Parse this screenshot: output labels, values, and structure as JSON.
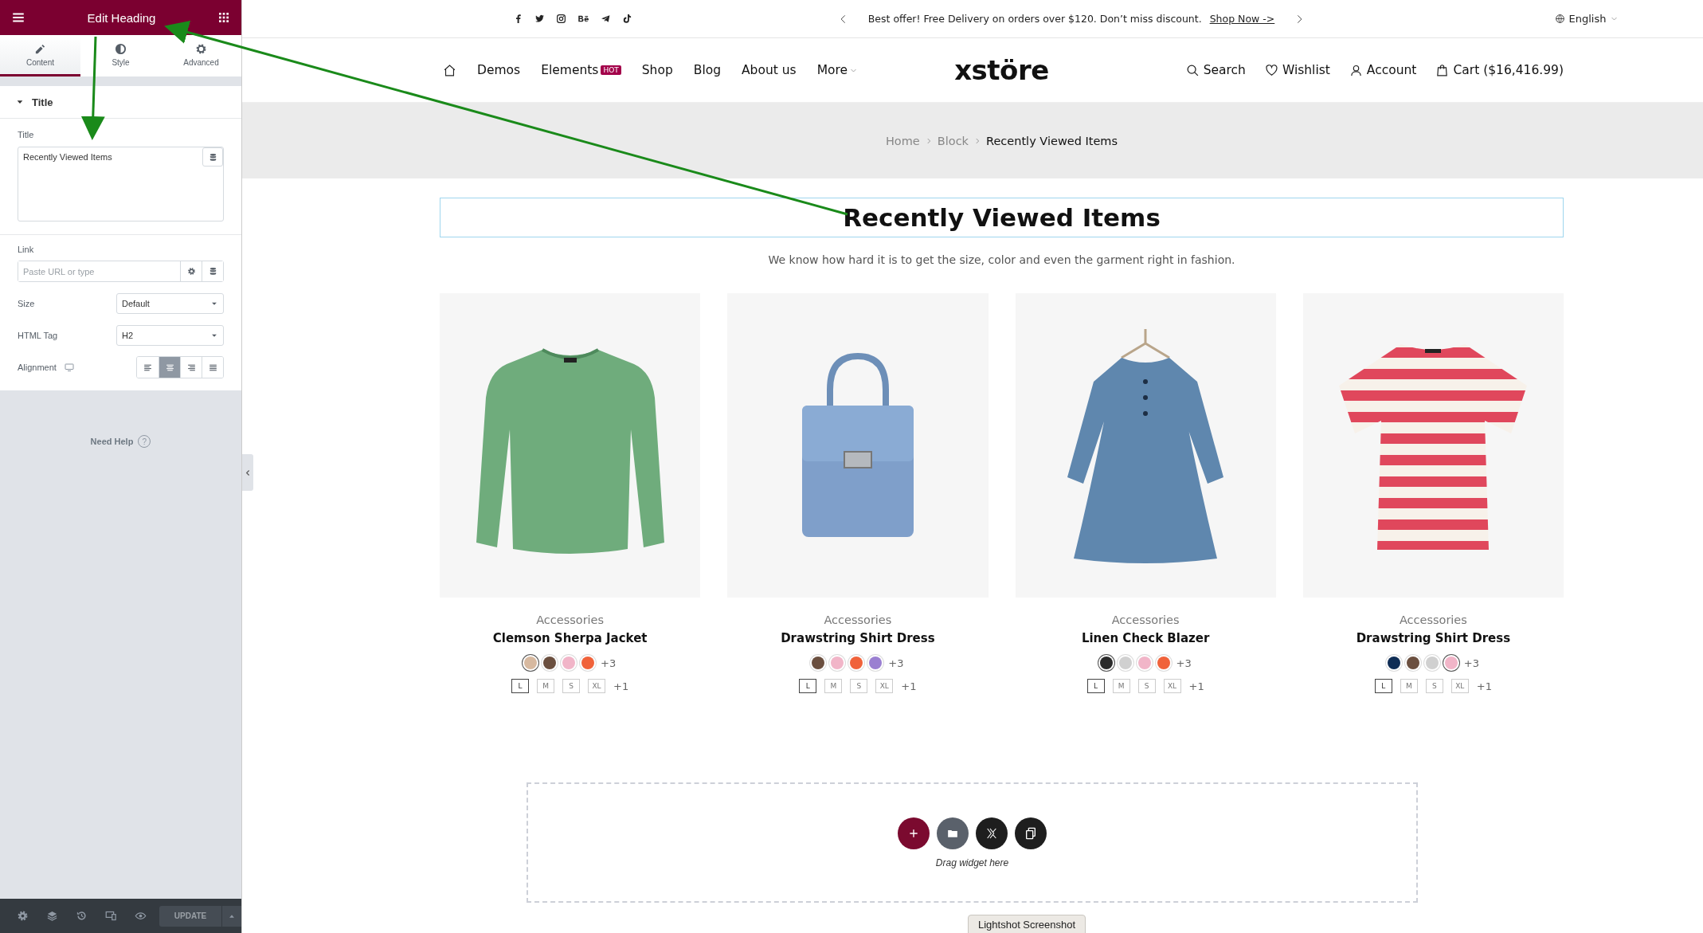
{
  "editor": {
    "title": "Edit Heading",
    "tabs": [
      {
        "label": "Content",
        "kind": "pencil",
        "selected": true
      },
      {
        "label": "Style",
        "kind": "contrast",
        "selected": false
      },
      {
        "label": "Advanced",
        "kind": "gear",
        "selected": false
      }
    ],
    "section": {
      "title": "Title",
      "expanded": true
    },
    "title_label": "Title",
    "title_value": "Recently Viewed Items",
    "link_label": "Link",
    "link_placeholder": "Paste URL or type",
    "size_label": "Size",
    "size_value": "Default",
    "tag_label": "HTML Tag",
    "tag_value": "H2",
    "alignment_label": "Alignment",
    "alignment_options": [
      {
        "kind": "left",
        "selected": false
      },
      {
        "kind": "center",
        "selected": true
      },
      {
        "kind": "right",
        "selected": false
      },
      {
        "kind": "justify",
        "selected": false
      }
    ],
    "need_help": "Need Help",
    "help_glyph": "?",
    "update_button": "UPDATE"
  },
  "top_bar": {
    "socials": [
      {
        "kind": "facebook"
      },
      {
        "kind": "twitter"
      },
      {
        "kind": "instagram"
      },
      {
        "kind": "behance"
      },
      {
        "kind": "telegram"
      },
      {
        "kind": "tiktok"
      }
    ],
    "promo": "Best offer! Free Delivery on orders over $120. Don’t miss discount.",
    "promo_link": "Shop Now ->",
    "language": "English"
  },
  "nav": {
    "items": [
      {
        "label": "Demos",
        "dropdown": false
      },
      {
        "label": "Elements",
        "badge": "HOT",
        "dropdown": false
      },
      {
        "label": "Shop",
        "dropdown": false
      },
      {
        "label": "Blog",
        "dropdown": false
      },
      {
        "label": "About us",
        "dropdown": false
      },
      {
        "label": "More",
        "dropdown": true
      }
    ],
    "logo": "xstöre",
    "actions": [
      {
        "kind": "search",
        "label": "Search"
      },
      {
        "kind": "heart",
        "label": "Wishlist"
      },
      {
        "kind": "user",
        "label": "Account"
      },
      {
        "kind": "bag",
        "label": "Cart ($16,416.99)"
      }
    ]
  },
  "breadcrumb": [
    {
      "label": "Home",
      "current": false
    },
    {
      "label": "Block",
      "current": false
    },
    {
      "label": "Recently Viewed Items",
      "current": true
    }
  ],
  "heading": "Recently Viewed Items",
  "subtitle": "We know how hard it is to get the size, color and even the garment right in fashion.",
  "products": [
    {
      "kind": "sweater",
      "category": "Accessories",
      "name": "Clemson Sherpa Jacket",
      "swatches": [
        {
          "color": "#d7b9a0",
          "selected": true
        },
        {
          "color": "#6b4f3f",
          "selected": false
        },
        {
          "color": "#f1b5c8",
          "selected": false
        },
        {
          "color": "#f0623a",
          "selected": false
        }
      ],
      "more_colors": "+3",
      "sizes": [
        {
          "label": "L",
          "selected": true
        },
        {
          "label": "M",
          "selected": false
        },
        {
          "label": "S",
          "selected": false
        },
        {
          "label": "XL",
          "selected": false
        }
      ],
      "more_sizes": "+1"
    },
    {
      "kind": "bag",
      "category": "Accessories",
      "name": "Drawstring Shirt Dress",
      "swatches": [
        {
          "color": "#6b4f3f",
          "selected": false
        },
        {
          "color": "#f1b5c8",
          "selected": false
        },
        {
          "color": "#f0623a",
          "selected": false
        },
        {
          "color": "#9a7fd1",
          "selected": false
        }
      ],
      "more_colors": "+3",
      "sizes": [
        {
          "label": "L",
          "selected": true
        },
        {
          "label": "M",
          "selected": false
        },
        {
          "label": "S",
          "selected": false
        },
        {
          "label": "XL",
          "selected": false
        }
      ],
      "more_sizes": "+1"
    },
    {
      "kind": "dress",
      "category": "Accessories",
      "name": "Linen Check Blazer",
      "swatches": [
        {
          "color": "#2b2b2b",
          "selected": true
        },
        {
          "color": "#d0d0d0",
          "selected": false
        },
        {
          "color": "#f1b5c8",
          "selected": false
        },
        {
          "color": "#f0623a",
          "selected": false
        }
      ],
      "more_colors": "+3",
      "sizes": [
        {
          "label": "L",
          "selected": true
        },
        {
          "label": "M",
          "selected": false
        },
        {
          "label": "S",
          "selected": false
        },
        {
          "label": "XL",
          "selected": false
        }
      ],
      "more_sizes": "+1"
    },
    {
      "kind": "tshirt",
      "category": "Accessories",
      "name": "Drawstring Shirt Dress",
      "swatches": [
        {
          "color": "#0f2d55",
          "selected": false
        },
        {
          "color": "#6b4f3f",
          "selected": false
        },
        {
          "color": "#d0d0d0",
          "selected": false
        },
        {
          "color": "#f1b5c8",
          "selected": true
        }
      ],
      "more_colors": "+3",
      "sizes": [
        {
          "label": "L",
          "selected": true
        },
        {
          "label": "M",
          "selected": false
        },
        {
          "label": "S",
          "selected": false
        },
        {
          "label": "XL",
          "selected": false
        }
      ],
      "more_sizes": "+1"
    }
  ],
  "drop_zone": {
    "hint": "Drag widget here",
    "buttons": [
      {
        "kind": "add"
      },
      {
        "kind": "folder"
      },
      {
        "kind": "x"
      },
      {
        "kind": "copy"
      }
    ]
  },
  "tooltip": "Lightshot Screenshot"
}
